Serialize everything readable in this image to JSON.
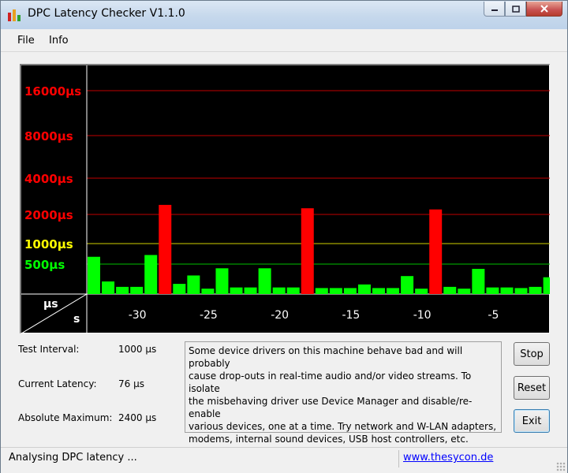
{
  "window": {
    "title": "DPC Latency Checker V1.1.0"
  },
  "menu": {
    "file": "File",
    "info": "Info"
  },
  "chart_data": {
    "type": "bar",
    "y_axis_labels": [
      {
        "text": "16000µs",
        "value": 16000,
        "color": "#ff0000"
      },
      {
        "text": "8000µs",
        "value": 8000,
        "color": "#ff0000"
      },
      {
        "text": "4000µs",
        "value": 4000,
        "color": "#ff0000"
      },
      {
        "text": "2000µs",
        "value": 2000,
        "color": "#ff0000"
      },
      {
        "text": "1000µs",
        "value": 1000,
        "color": "#ffff00"
      },
      {
        "text": "500µs",
        "value": 500,
        "color": "#00ff00"
      }
    ],
    "x_tick_labels": [
      "-30",
      "-25",
      "-20",
      "-15",
      "-10",
      "-5"
    ],
    "x_ticks": [
      -30,
      -25,
      -20,
      -15,
      -10,
      -5
    ],
    "x_range": [
      -33,
      0
    ],
    "corner_labels": {
      "y_unit": "µs",
      "x_unit": "s"
    },
    "values_us": [
      640,
      210,
      120,
      120,
      680,
      2400,
      170,
      310,
      90,
      430,
      110,
      110,
      430,
      110,
      110,
      2250,
      100,
      100,
      100,
      160,
      100,
      100,
      300,
      90,
      2200,
      120,
      90,
      420,
      110,
      110,
      100,
      120,
      280
    ],
    "threshold_color_red": "#ff0000",
    "threshold_color_green": "#00ff00",
    "red_threshold_us": 2000
  },
  "stats": {
    "test_interval_label": "Test Interval:",
    "test_interval_value": "1000 µs",
    "current_latency_label": "Current Latency:",
    "current_latency_value": "76 µs",
    "absolute_max_label": "Absolute Maximum:",
    "absolute_max_value": "2400 µs"
  },
  "message": {
    "lines": [
      "Some device drivers on this machine behave bad and will probably",
      "cause drop-outs in real-time audio and/or video streams. To isolate",
      "the misbehaving driver use Device Manager and disable/re-enable",
      "various devices, one at a time. Try network and W-LAN adapters,",
      "modems, internal sound devices, USB host controllers, etc."
    ]
  },
  "buttons": {
    "stop": "Stop",
    "reset": "Reset",
    "exit": "Exit"
  },
  "status": {
    "text": "Analysing DPC latency ...",
    "link": "www.thesycon.de"
  }
}
